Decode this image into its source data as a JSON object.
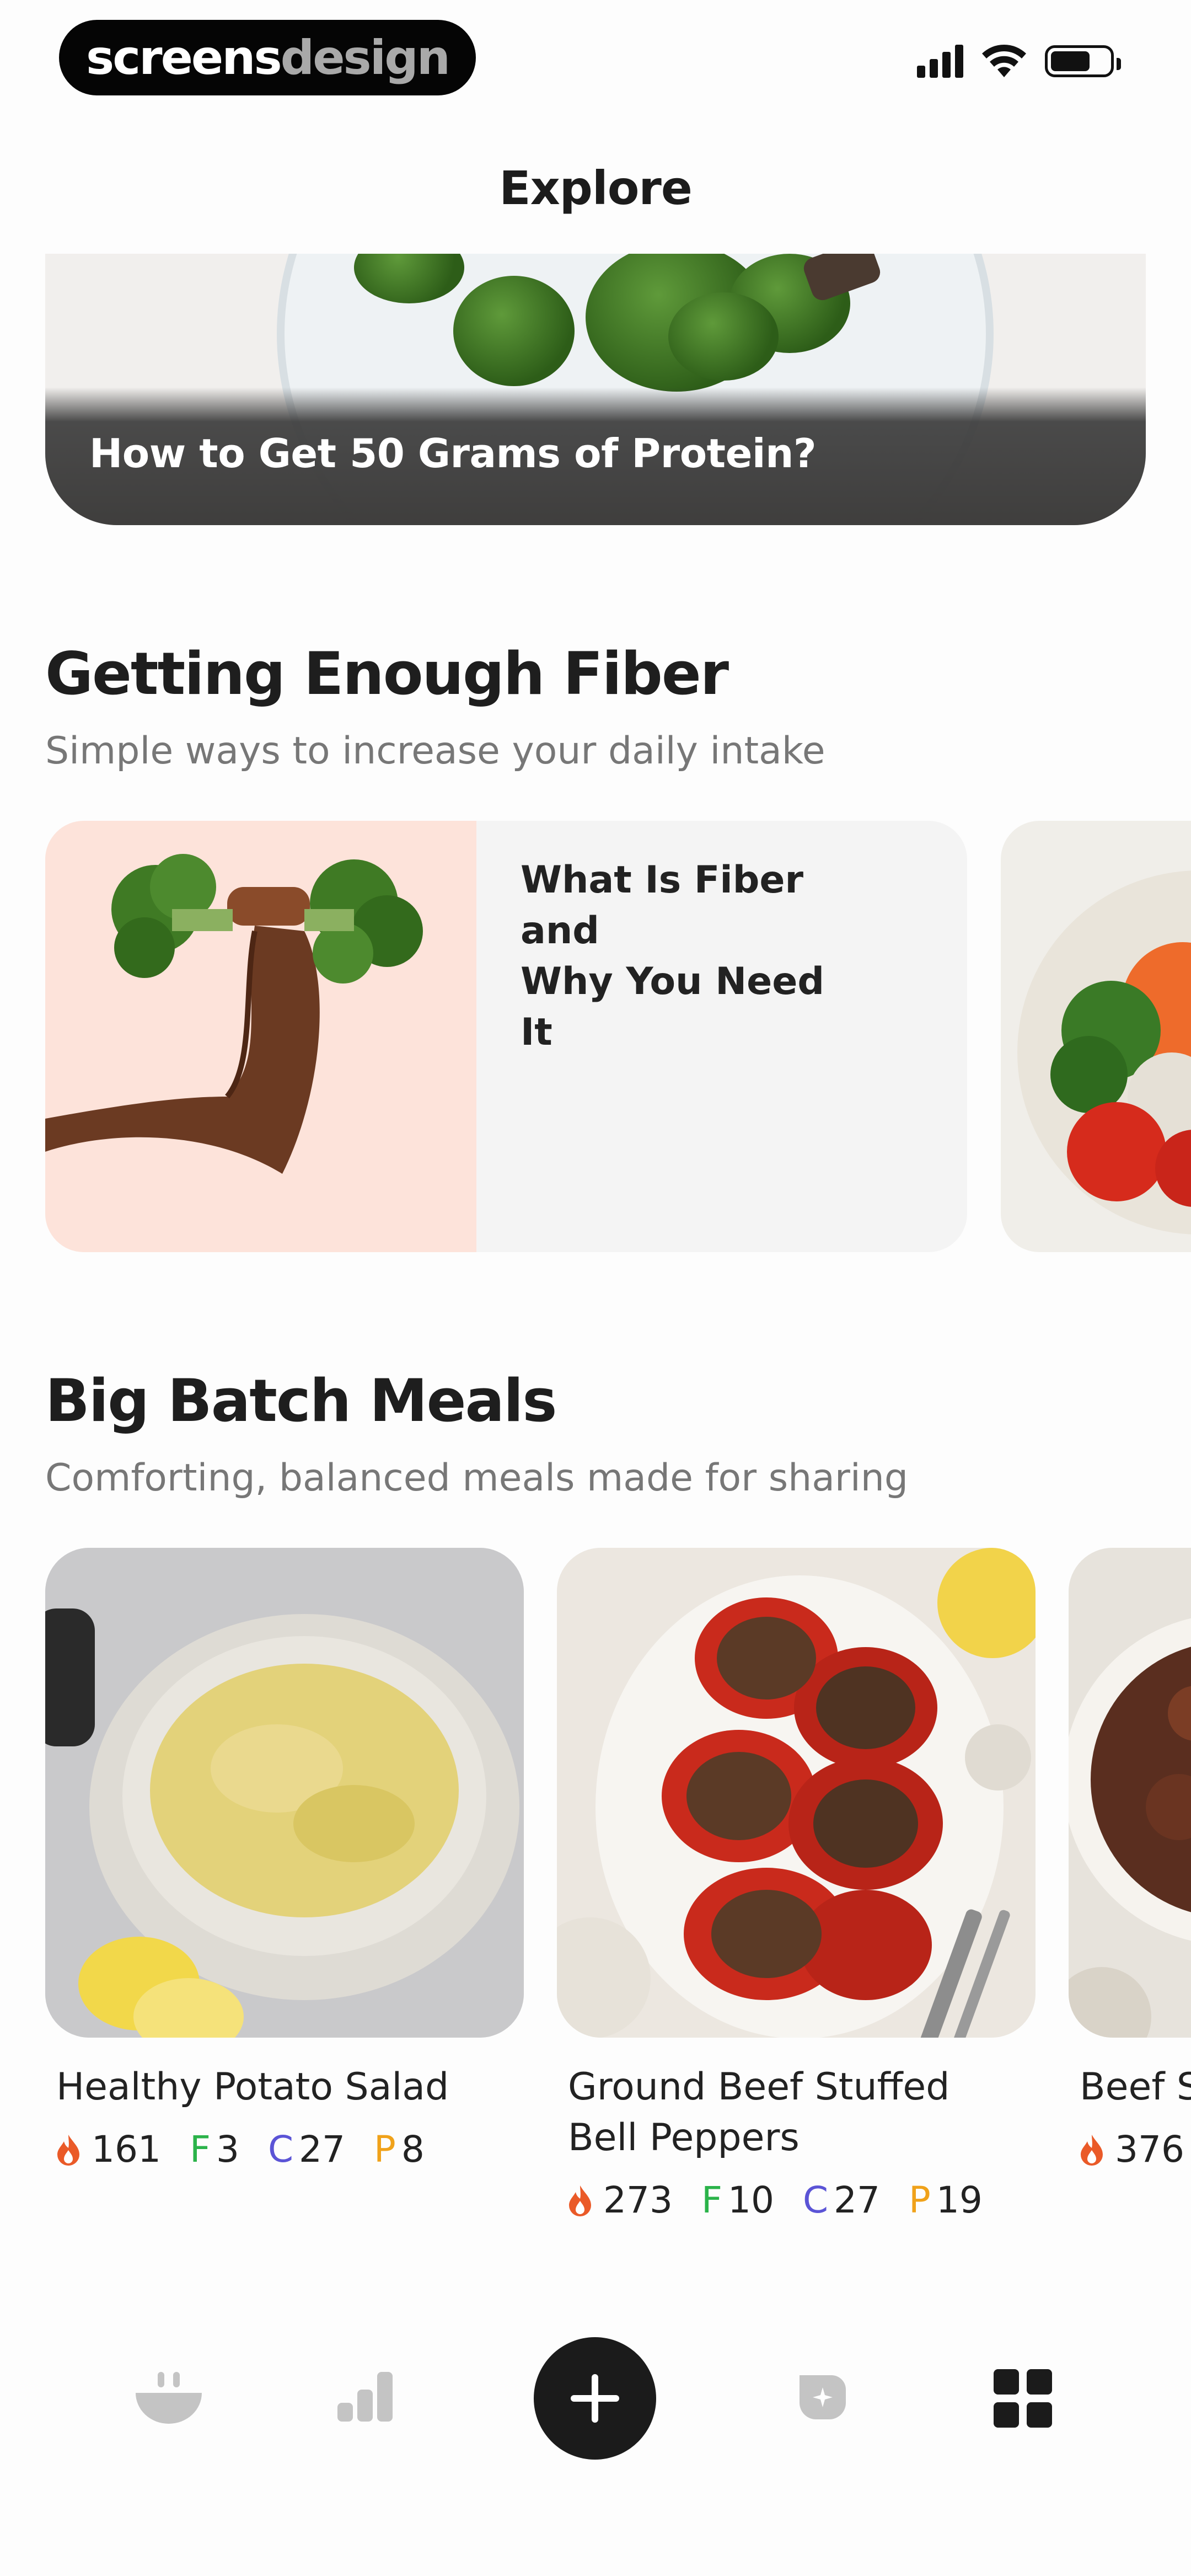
{
  "status_bar": {
    "logo_part1": "screens",
    "logo_part2": "design"
  },
  "header": {
    "title": "Explore"
  },
  "hero": {
    "caption": "How to Get 50 Grams of Protein?"
  },
  "fiber_section": {
    "title": "Getting Enough Fiber",
    "subtitle": "Simple ways to increase your daily intake",
    "cards": [
      {
        "title_line1": "What Is Fiber and",
        "title_line2": "Why You Need It"
      }
    ]
  },
  "batch_section": {
    "title": "Big Batch Meals",
    "subtitle": "Comforting, balanced meals made for sharing",
    "meals": [
      {
        "name_line1": "Healthy Potato Salad",
        "name_line2": "",
        "calories": "161",
        "fat_label": "F",
        "fat": "3",
        "carb_label": "C",
        "carbs": "27",
        "protein_label": "P",
        "protein": "8"
      },
      {
        "name_line1": "Ground Beef Stuffed",
        "name_line2": "Bell Peppers",
        "calories": "273",
        "fat_label": "F",
        "fat": "10",
        "carb_label": "C",
        "carbs": "27",
        "protein_label": "P",
        "protein": "19"
      },
      {
        "name_line1": "Beef S",
        "calories": "376"
      }
    ]
  },
  "colors": {
    "fat": "#2bb34a",
    "carbs": "#5b54d6",
    "protein": "#f0a21a",
    "flame": "#ea5a28",
    "nav_inactive": "#c4c4c4",
    "nav_active": "#1b1b1b"
  },
  "bottom_nav": {
    "items": [
      {
        "icon": "bowl-icon",
        "active": false
      },
      {
        "icon": "stats-bars-icon",
        "active": false
      },
      {
        "icon": "add-icon",
        "active": false
      },
      {
        "icon": "badge-plus-icon",
        "active": false
      },
      {
        "icon": "grid-icon",
        "active": true
      }
    ]
  }
}
